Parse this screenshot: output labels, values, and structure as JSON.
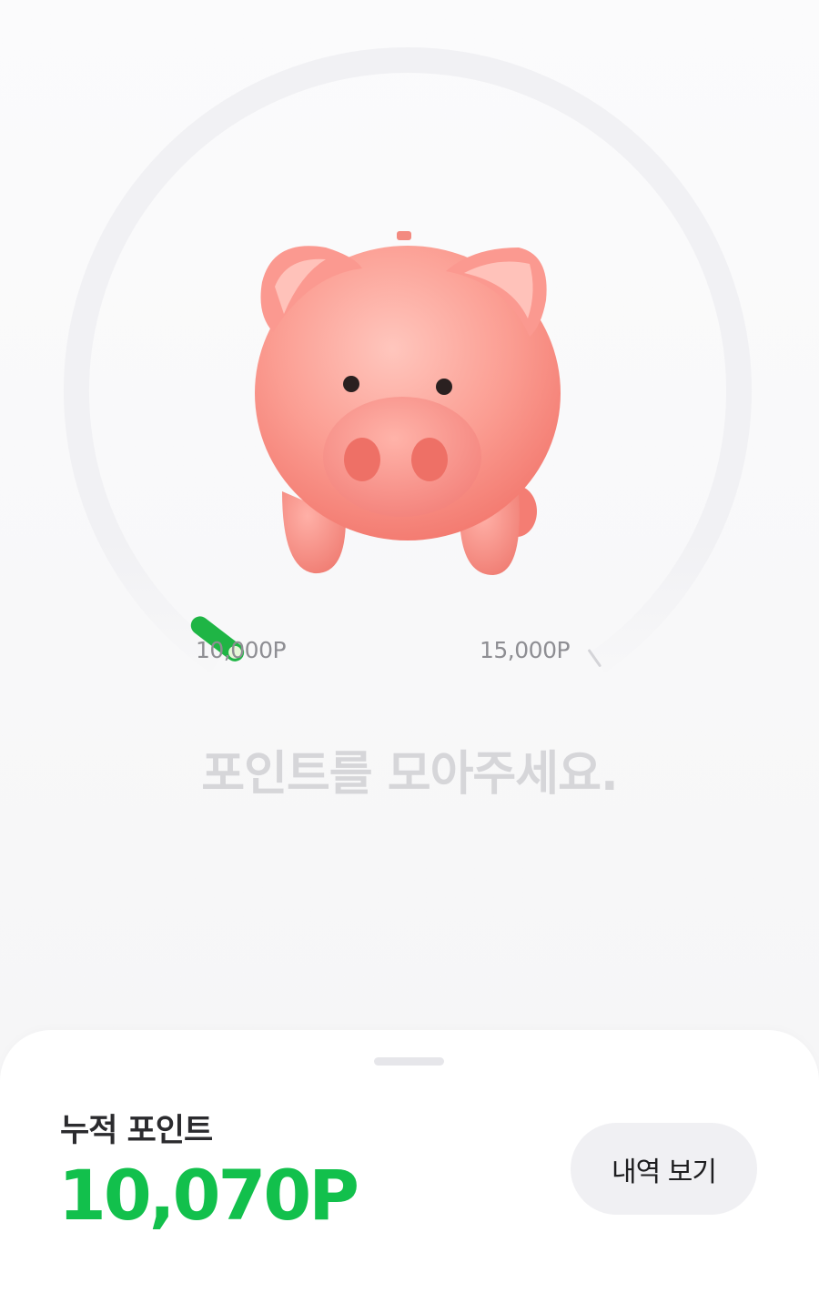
{
  "gauge": {
    "min_label": "10,000P",
    "max_label": "15,000P",
    "min_value": 10000,
    "max_value": 15000,
    "current_value": 10070,
    "track_color": "#f1f1f4",
    "progress_color": "#1fb545",
    "knob_color": "#e6f7d8"
  },
  "main": {
    "illustration": "piggy-bank",
    "message": "포인트를 모아주세요."
  },
  "sheet": {
    "points_label": "누적 포인트",
    "points_value": "10,070P",
    "points_color": "#12c04c",
    "history_button_label": "내역 보기"
  }
}
